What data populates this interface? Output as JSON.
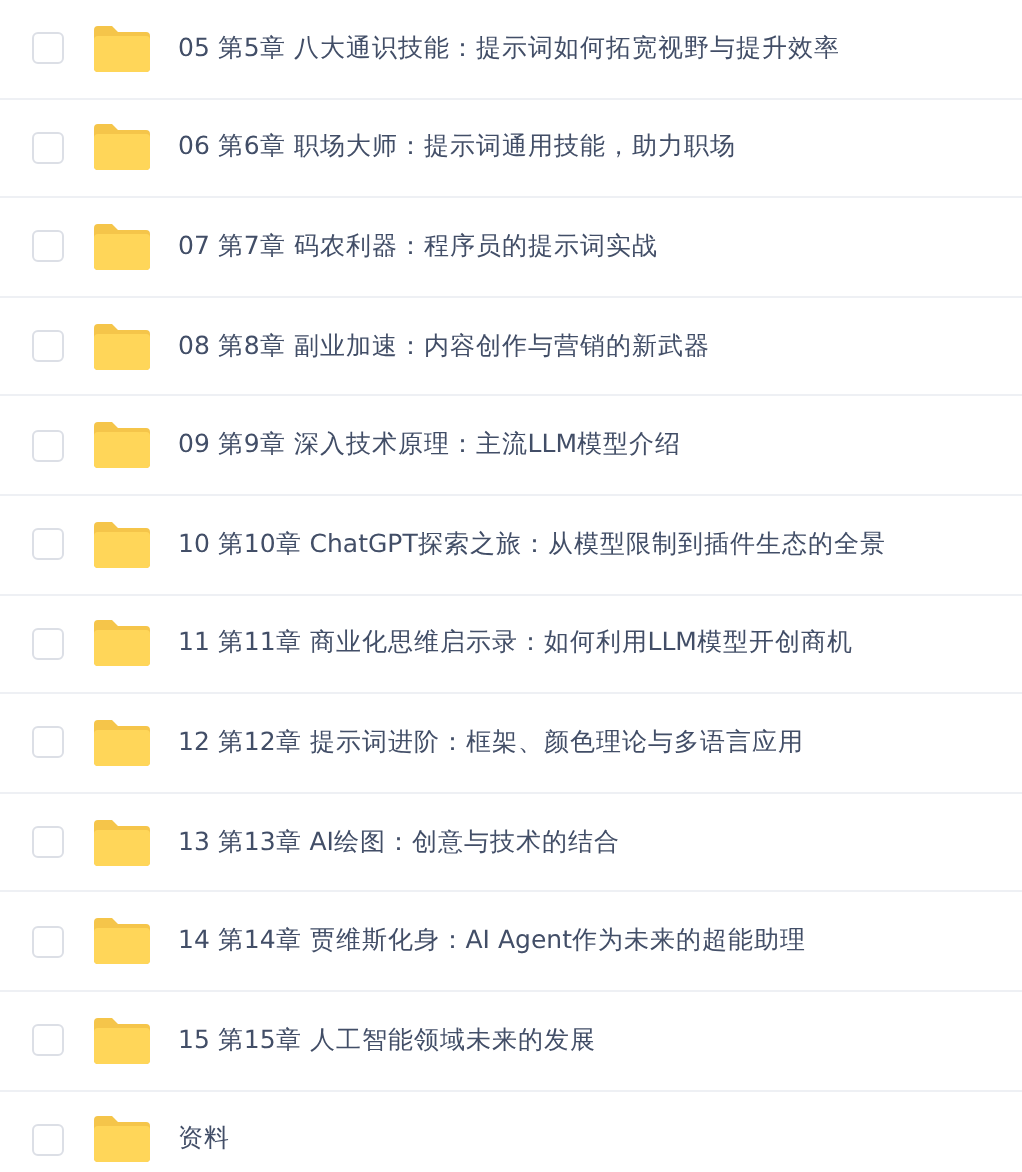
{
  "files": [
    {
      "name": "05 第5章 八大通识技能：提示词如何拓宽视野与提升效率",
      "checked": false
    },
    {
      "name": "06 第6章 职场大师：提示词通用技能，助力职场",
      "checked": false
    },
    {
      "name": "07 第7章 码农利器：程序员的提示词实战",
      "checked": false
    },
    {
      "name": "08 第8章 副业加速：内容创作与营销的新武器",
      "checked": false
    },
    {
      "name": "09 第9章 深入技术原理：主流LLM模型介绍",
      "checked": false
    },
    {
      "name": "10 第10章 ChatGPT探索之旅：从模型限制到插件生态的全景",
      "checked": false
    },
    {
      "name": "11 第11章 商业化思维启示录：如何利用LLM模型开创商机",
      "checked": false
    },
    {
      "name": "12 第12章 提示词进阶：框架、颜色理论与多语言应用",
      "checked": false
    },
    {
      "name": "13 第13章 AI绘图：创意与技术的结合",
      "checked": false
    },
    {
      "name": "14 第14章 贾维斯化身：AI Agent作为未来的超能助理",
      "checked": false
    },
    {
      "name": "15 第15章 人工智能领域未来的发展",
      "checked": false
    },
    {
      "name": "资料",
      "checked": false
    }
  ]
}
